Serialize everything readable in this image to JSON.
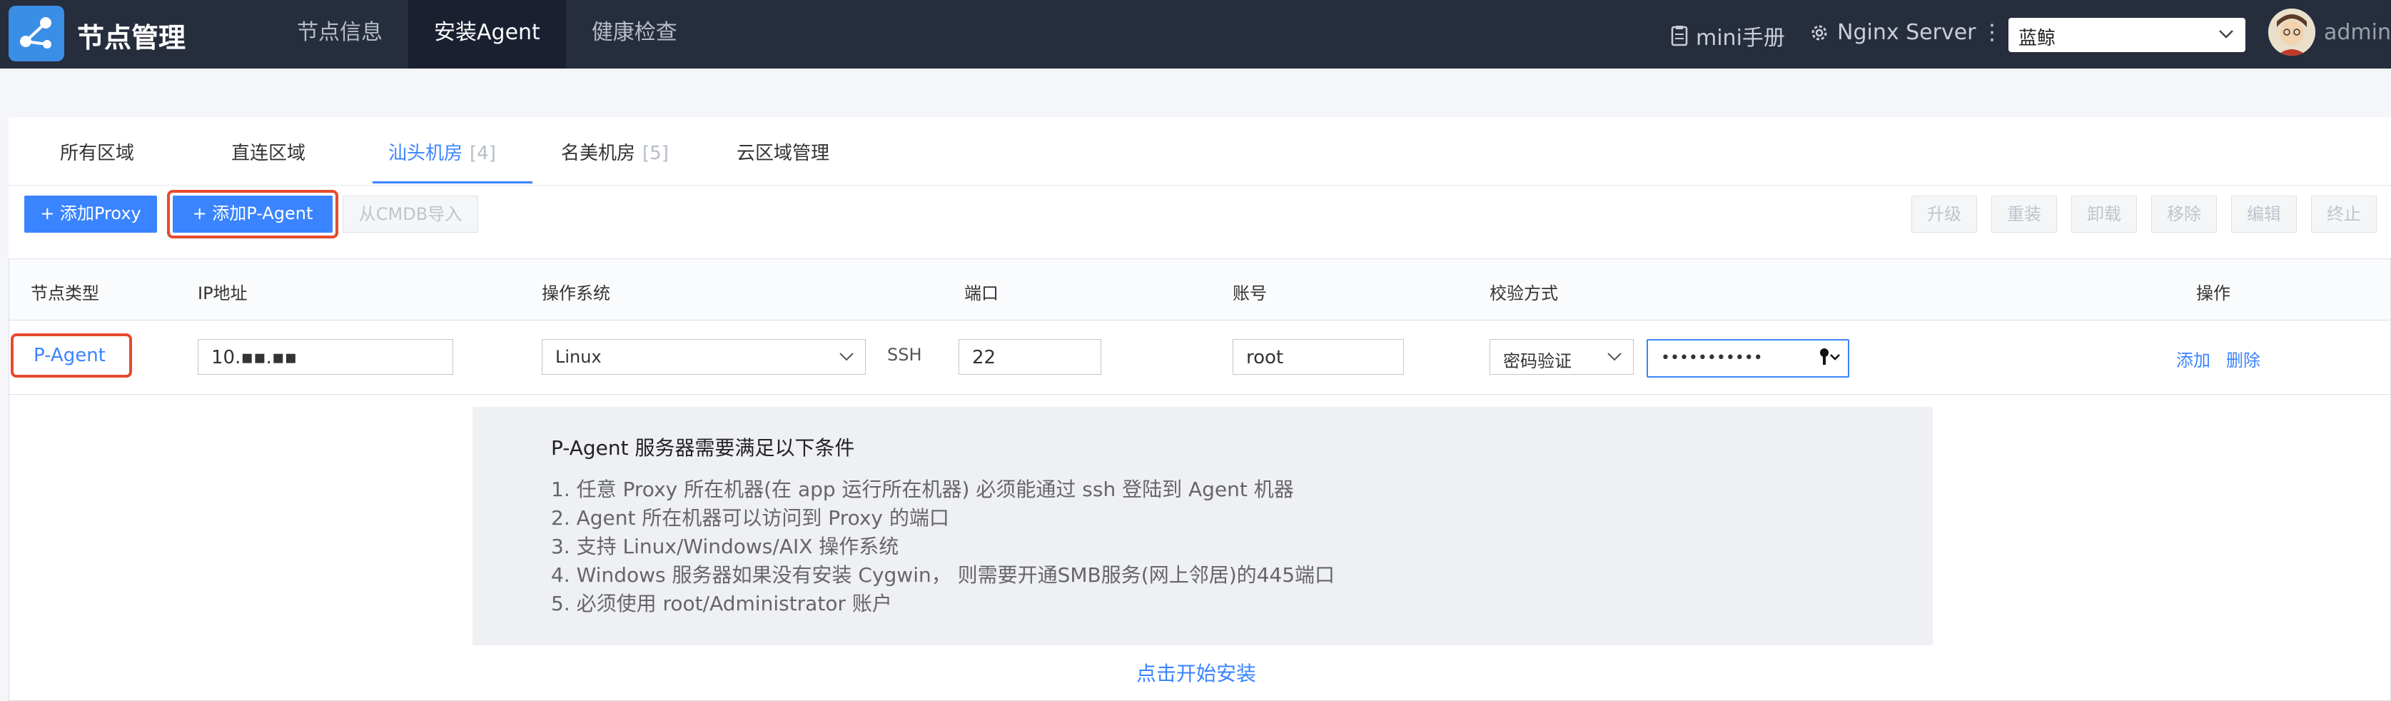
{
  "header": {
    "app_title": "节点管理",
    "nav": [
      "节点信息",
      "安装Agent",
      "健康检查"
    ],
    "active_nav": "安装Agent",
    "manual_label": "mini手册",
    "server_label": "Nginx Server",
    "business_select": "蓝鲸",
    "username": "admin"
  },
  "tabs": {
    "items": [
      {
        "label": "所有区域",
        "count": ""
      },
      {
        "label": "直连区域",
        "count": ""
      },
      {
        "label": "汕头机房",
        "count": "[4]"
      },
      {
        "label": "名美机房",
        "count": "[5]"
      },
      {
        "label": "云区域管理",
        "count": ""
      }
    ],
    "active": "汕头机房"
  },
  "toolbar": {
    "add_proxy": "+ 添加Proxy",
    "add_p_agent": "+ 添加P-Agent",
    "import_cmdb": "从CMDB导入",
    "right_actions": [
      "升级",
      "重装",
      "卸载",
      "移除",
      "编辑",
      "终止"
    ]
  },
  "table": {
    "headers": [
      "节点类型",
      "IP地址",
      "操作系统",
      "端口",
      "账号",
      "校验方式",
      "操作"
    ],
    "row": {
      "node_type": "P-Agent",
      "ip": "10.▪▪.▪▪",
      "os": "Linux",
      "protocol": "SSH",
      "port": "22",
      "account": "root",
      "auth_method": "密码验证",
      "password_mask": "•••••••••••",
      "actions": [
        "添加",
        "删除"
      ]
    }
  },
  "requirements": {
    "title": "P-Agent 服务器需要满足以下条件",
    "items": [
      "1. 任意 Proxy 所在机器(在 app 运行所在机器) 必须能通过 ssh 登陆到 Agent 机器",
      "2. Agent 所在机器可以访问到 Proxy 的端口",
      "3. 支持 Linux/Windows/AIX 操作系统",
      "4. Windows 服务器如果没有安装 Cygwin， 则需要开通SMB服务(网上邻居)的445端口",
      "5. 必须使用 root/Administrator 账户"
    ]
  },
  "start_install": "点击开始安装",
  "colors": {
    "primary": "#3a84ff",
    "header_bg": "#262d3c",
    "highlight": "#e64a2e"
  }
}
